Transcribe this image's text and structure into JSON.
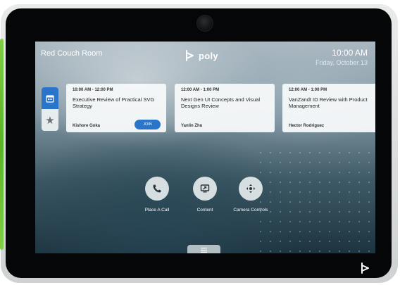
{
  "header": {
    "room_name": "Red Couch Room",
    "brand": "poly",
    "time": "10:00 AM",
    "date": "Friday, October 13"
  },
  "side_tabs": [
    {
      "name": "calendar",
      "icon": "calendar-icon",
      "active": true
    },
    {
      "name": "favorites",
      "icon": "star-icon",
      "active": false
    }
  ],
  "meetings": [
    {
      "time": "10:00 AM - 12:00 PM",
      "title": "Executive Review of Practical SVG Strategy",
      "host": "Kishore Goka",
      "action": "JOIN"
    },
    {
      "time": "12:00 AM - 1:00 PM",
      "title": "Next Gen UI Concepts and Visual Designs Review",
      "host": "Yanlin Zhu"
    },
    {
      "time": "12:00 AM - 1:00 PM",
      "title": "VanZandt ID Review with Product Management",
      "host": "Hector Rodriguez"
    }
  ],
  "actions": [
    {
      "label": "Place A Call",
      "icon": "phone-icon"
    },
    {
      "label": "Content",
      "icon": "content-share-icon"
    },
    {
      "label": "Camera Controls",
      "icon": "camera-control-icon"
    }
  ],
  "menu": {
    "icon": "menu-icon"
  },
  "colors": {
    "accent": "#2a74c9",
    "bezel": "#050607",
    "frame": "#dcdfe0",
    "green_edge": "#58b327"
  }
}
